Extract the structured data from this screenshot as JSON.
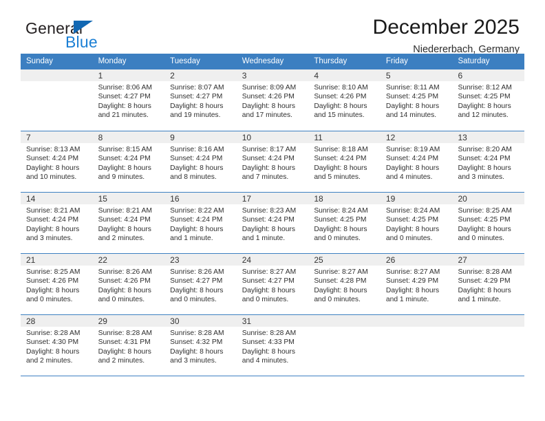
{
  "brand": {
    "name_part1": "General",
    "name_part2": "Blue",
    "triangle_color": "#1268b3",
    "blue_color": "#1b7fd4"
  },
  "header": {
    "title": "December 2025",
    "subtitle": "Niedererbach, Germany"
  },
  "colors": {
    "header_band": "#3c7fc1",
    "day_band": "#efefef",
    "divider": "#3c7fc1",
    "text": "#2e2e2e"
  },
  "weekdays": [
    "Sunday",
    "Monday",
    "Tuesday",
    "Wednesday",
    "Thursday",
    "Friday",
    "Saturday"
  ],
  "weeks": [
    [
      {
        "day": "",
        "lines": []
      },
      {
        "day": "1",
        "lines": [
          "Sunrise: 8:06 AM",
          "Sunset: 4:27 PM",
          "Daylight: 8 hours",
          "and 21 minutes."
        ]
      },
      {
        "day": "2",
        "lines": [
          "Sunrise: 8:07 AM",
          "Sunset: 4:27 PM",
          "Daylight: 8 hours",
          "and 19 minutes."
        ]
      },
      {
        "day": "3",
        "lines": [
          "Sunrise: 8:09 AM",
          "Sunset: 4:26 PM",
          "Daylight: 8 hours",
          "and 17 minutes."
        ]
      },
      {
        "day": "4",
        "lines": [
          "Sunrise: 8:10 AM",
          "Sunset: 4:26 PM",
          "Daylight: 8 hours",
          "and 15 minutes."
        ]
      },
      {
        "day": "5",
        "lines": [
          "Sunrise: 8:11 AM",
          "Sunset: 4:25 PM",
          "Daylight: 8 hours",
          "and 14 minutes."
        ]
      },
      {
        "day": "6",
        "lines": [
          "Sunrise: 8:12 AM",
          "Sunset: 4:25 PM",
          "Daylight: 8 hours",
          "and 12 minutes."
        ]
      }
    ],
    [
      {
        "day": "7",
        "lines": [
          "Sunrise: 8:13 AM",
          "Sunset: 4:24 PM",
          "Daylight: 8 hours",
          "and 10 minutes."
        ]
      },
      {
        "day": "8",
        "lines": [
          "Sunrise: 8:15 AM",
          "Sunset: 4:24 PM",
          "Daylight: 8 hours",
          "and 9 minutes."
        ]
      },
      {
        "day": "9",
        "lines": [
          "Sunrise: 8:16 AM",
          "Sunset: 4:24 PM",
          "Daylight: 8 hours",
          "and 8 minutes."
        ]
      },
      {
        "day": "10",
        "lines": [
          "Sunrise: 8:17 AM",
          "Sunset: 4:24 PM",
          "Daylight: 8 hours",
          "and 7 minutes."
        ]
      },
      {
        "day": "11",
        "lines": [
          "Sunrise: 8:18 AM",
          "Sunset: 4:24 PM",
          "Daylight: 8 hours",
          "and 5 minutes."
        ]
      },
      {
        "day": "12",
        "lines": [
          "Sunrise: 8:19 AM",
          "Sunset: 4:24 PM",
          "Daylight: 8 hours",
          "and 4 minutes."
        ]
      },
      {
        "day": "13",
        "lines": [
          "Sunrise: 8:20 AM",
          "Sunset: 4:24 PM",
          "Daylight: 8 hours",
          "and 3 minutes."
        ]
      }
    ],
    [
      {
        "day": "14",
        "lines": [
          "Sunrise: 8:21 AM",
          "Sunset: 4:24 PM",
          "Daylight: 8 hours",
          "and 3 minutes."
        ]
      },
      {
        "day": "15",
        "lines": [
          "Sunrise: 8:21 AM",
          "Sunset: 4:24 PM",
          "Daylight: 8 hours",
          "and 2 minutes."
        ]
      },
      {
        "day": "16",
        "lines": [
          "Sunrise: 8:22 AM",
          "Sunset: 4:24 PM",
          "Daylight: 8 hours",
          "and 1 minute."
        ]
      },
      {
        "day": "17",
        "lines": [
          "Sunrise: 8:23 AM",
          "Sunset: 4:24 PM",
          "Daylight: 8 hours",
          "and 1 minute."
        ]
      },
      {
        "day": "18",
        "lines": [
          "Sunrise: 8:24 AM",
          "Sunset: 4:25 PM",
          "Daylight: 8 hours",
          "and 0 minutes."
        ]
      },
      {
        "day": "19",
        "lines": [
          "Sunrise: 8:24 AM",
          "Sunset: 4:25 PM",
          "Daylight: 8 hours",
          "and 0 minutes."
        ]
      },
      {
        "day": "20",
        "lines": [
          "Sunrise: 8:25 AM",
          "Sunset: 4:25 PM",
          "Daylight: 8 hours",
          "and 0 minutes."
        ]
      }
    ],
    [
      {
        "day": "21",
        "lines": [
          "Sunrise: 8:25 AM",
          "Sunset: 4:26 PM",
          "Daylight: 8 hours",
          "and 0 minutes."
        ]
      },
      {
        "day": "22",
        "lines": [
          "Sunrise: 8:26 AM",
          "Sunset: 4:26 PM",
          "Daylight: 8 hours",
          "and 0 minutes."
        ]
      },
      {
        "day": "23",
        "lines": [
          "Sunrise: 8:26 AM",
          "Sunset: 4:27 PM",
          "Daylight: 8 hours",
          "and 0 minutes."
        ]
      },
      {
        "day": "24",
        "lines": [
          "Sunrise: 8:27 AM",
          "Sunset: 4:27 PM",
          "Daylight: 8 hours",
          "and 0 minutes."
        ]
      },
      {
        "day": "25",
        "lines": [
          "Sunrise: 8:27 AM",
          "Sunset: 4:28 PM",
          "Daylight: 8 hours",
          "and 0 minutes."
        ]
      },
      {
        "day": "26",
        "lines": [
          "Sunrise: 8:27 AM",
          "Sunset: 4:29 PM",
          "Daylight: 8 hours",
          "and 1 minute."
        ]
      },
      {
        "day": "27",
        "lines": [
          "Sunrise: 8:28 AM",
          "Sunset: 4:29 PM",
          "Daylight: 8 hours",
          "and 1 minute."
        ]
      }
    ],
    [
      {
        "day": "28",
        "lines": [
          "Sunrise: 8:28 AM",
          "Sunset: 4:30 PM",
          "Daylight: 8 hours",
          "and 2 minutes."
        ]
      },
      {
        "day": "29",
        "lines": [
          "Sunrise: 8:28 AM",
          "Sunset: 4:31 PM",
          "Daylight: 8 hours",
          "and 2 minutes."
        ]
      },
      {
        "day": "30",
        "lines": [
          "Sunrise: 8:28 AM",
          "Sunset: 4:32 PM",
          "Daylight: 8 hours",
          "and 3 minutes."
        ]
      },
      {
        "day": "31",
        "lines": [
          "Sunrise: 8:28 AM",
          "Sunset: 4:33 PM",
          "Daylight: 8 hours",
          "and 4 minutes."
        ]
      },
      {
        "day": "",
        "lines": []
      },
      {
        "day": "",
        "lines": []
      },
      {
        "day": "",
        "lines": []
      }
    ]
  ]
}
